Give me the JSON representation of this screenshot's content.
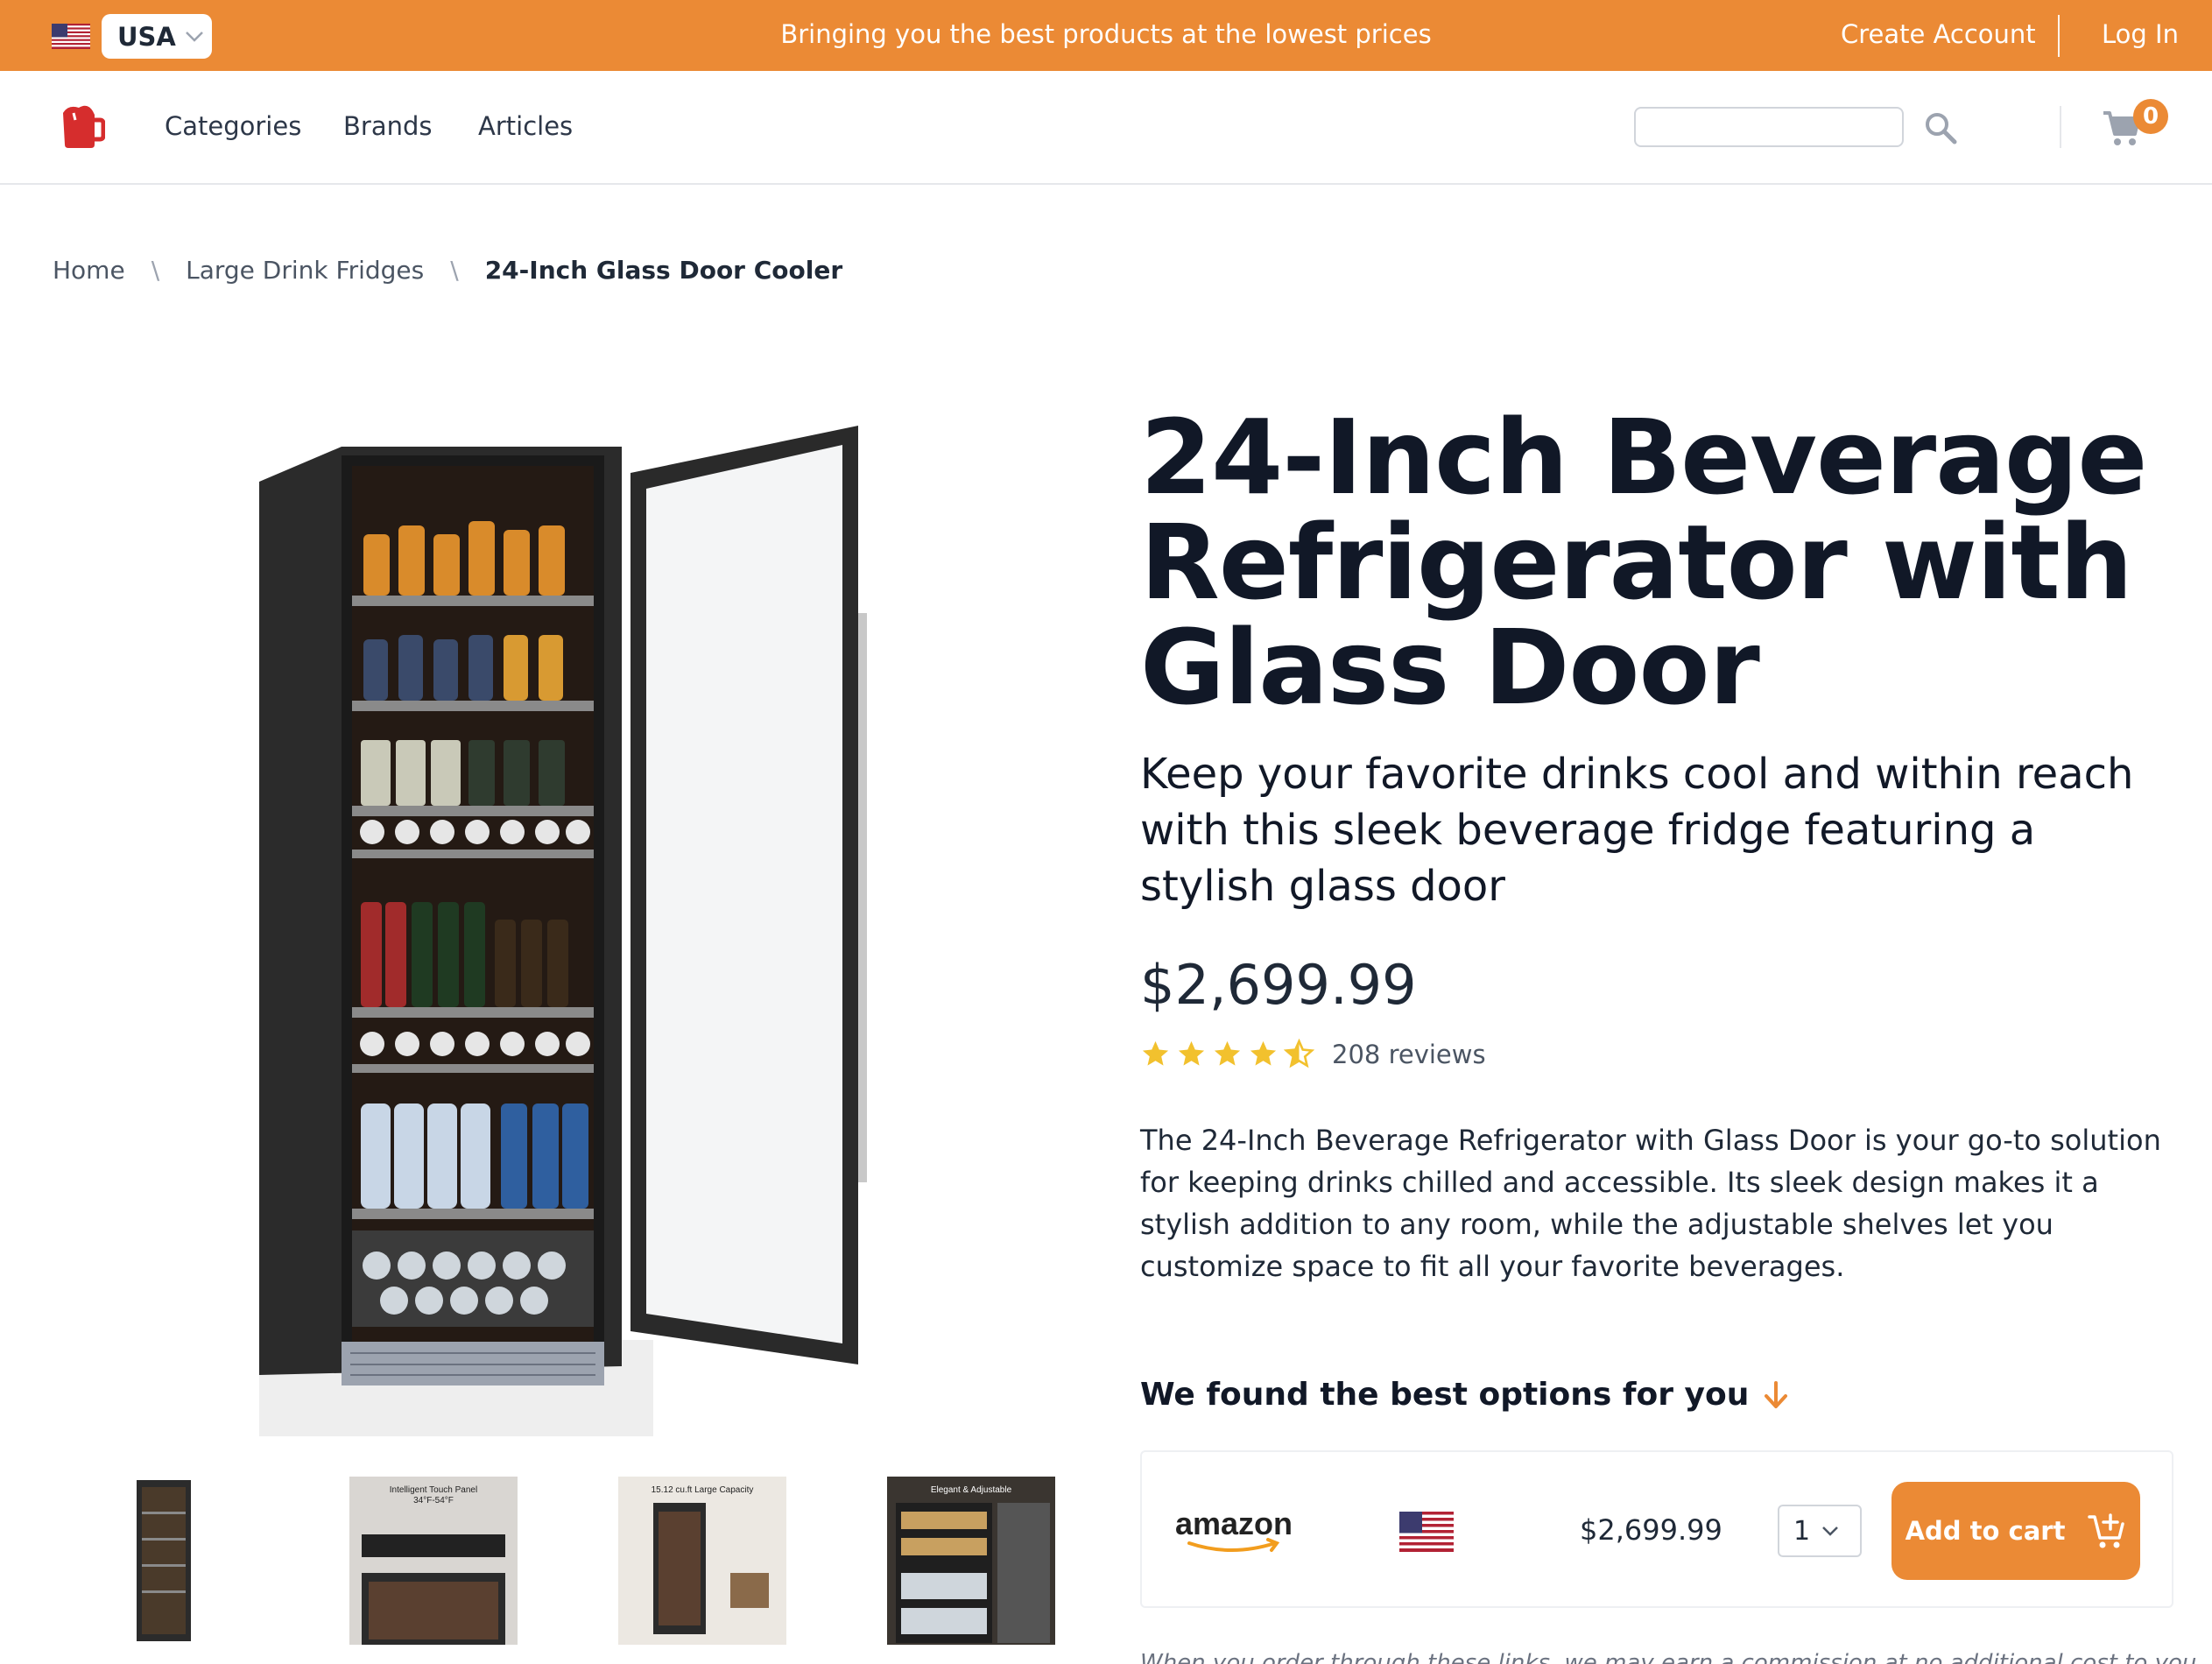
{
  "topbar": {
    "country": "USA",
    "tagline": "Bringing you the best products at the lowest prices",
    "create_account": "Create Account",
    "login": "Log In"
  },
  "nav": {
    "links": [
      "Categories",
      "Brands",
      "Articles"
    ],
    "search_placeholder": "",
    "cart_count": "0"
  },
  "breadcrumb": [
    "Home",
    "Large Drink Fridges",
    "24-Inch Glass Door Cooler"
  ],
  "breadcrumb_separator": "\\",
  "product": {
    "title": "24-Inch Beverage Refrigerator with Glass Door",
    "subtitle": "Keep your favorite drinks cool and within reach with this sleek beverage fridge featuring a stylish glass door",
    "price": "$2,699.99",
    "rating": 4.5,
    "reviews": "208 reviews",
    "description": "The 24-Inch Beverage Refrigerator with Glass Door is your go-to solution for keeping drinks chilled and accessible. Its sleek design makes it a stylish addition to any room, while the adjustable shelves let you customize space to fit all your favorite beverages.",
    "thumbnails": [
      {
        "caption": ""
      },
      {
        "caption": "Intelligent Touch Panel",
        "sub": "34°F-54°F"
      },
      {
        "caption": "15.12 cu.ft Large Capacity"
      },
      {
        "caption": "Elegant & Adjustable"
      }
    ]
  },
  "offers": {
    "heading": "We found the best options for you",
    "items": [
      {
        "store": "amazon",
        "price": "$2,699.99",
        "qty": "1",
        "button": "Add to cart"
      }
    ],
    "disclaimer": "When you order through these links, we may earn a commission at no additional cost to you."
  },
  "colors": {
    "accent": "#eb8a35",
    "star": "#f2c12e"
  }
}
